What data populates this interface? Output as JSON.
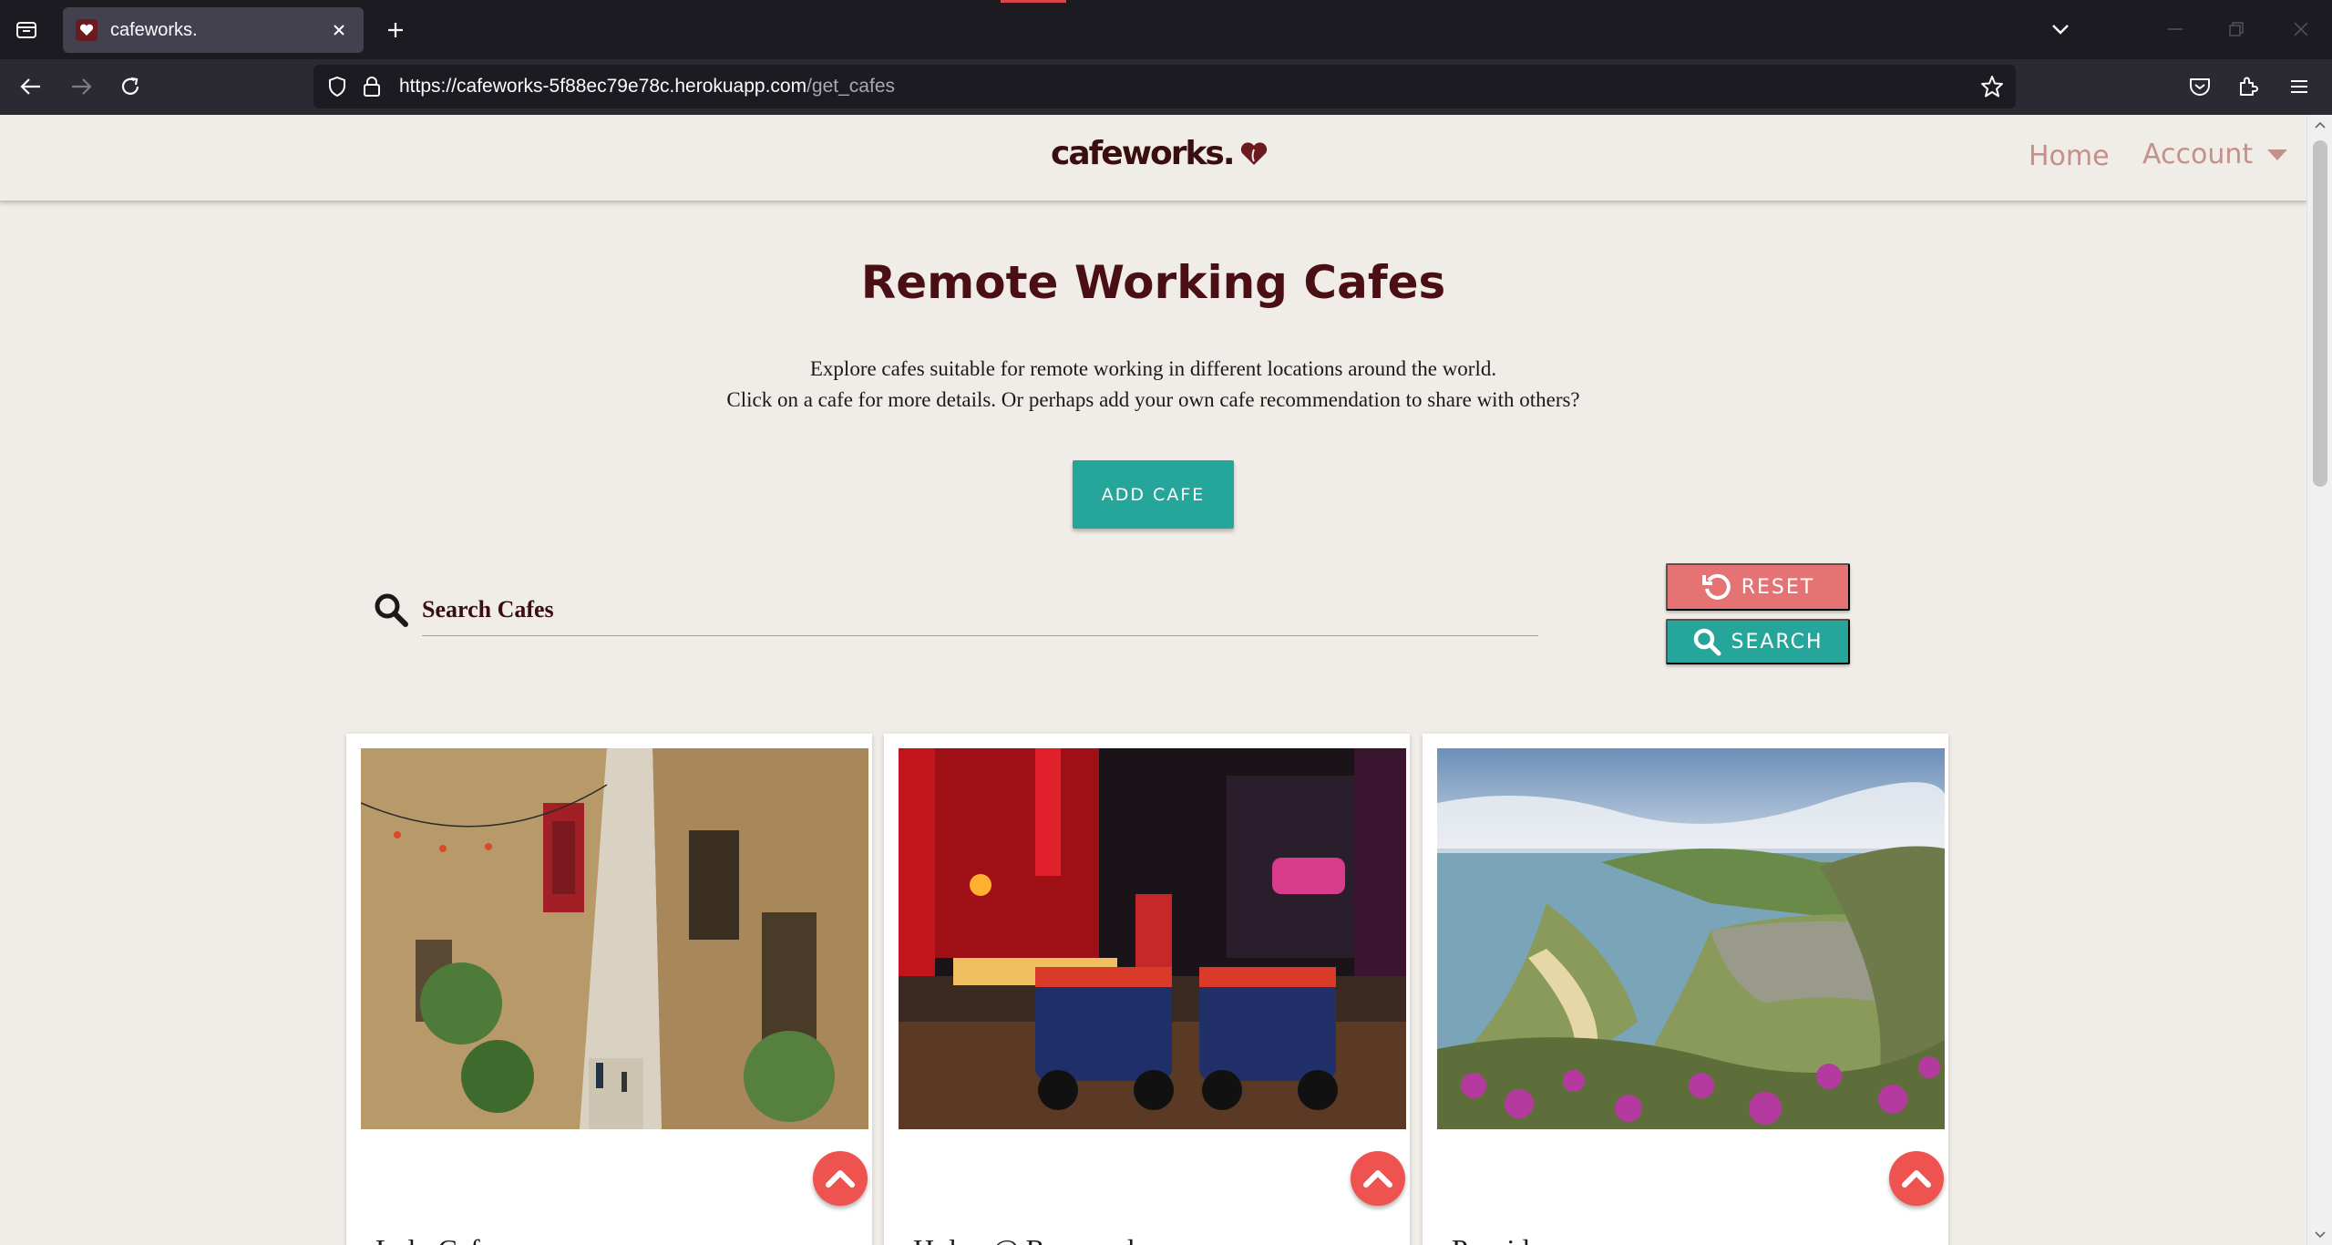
{
  "browser": {
    "tab_title": "cafeworks.",
    "url_host": "https://cafeworks-5f88ec79e78c.herokuapp.com",
    "url_path": "/get_cafes"
  },
  "site": {
    "logo": "cafeworks.",
    "nav": {
      "home": "Home",
      "account": "Account"
    },
    "title": "Remote Working Cafes",
    "intro_line1": "Explore cafes suitable for remote working in different locations around the world.",
    "intro_line2": "Click on a cafe for more details. Or perhaps add your own cafe recommendation to share with others?",
    "add_button": "ADD CAFE",
    "search": {
      "placeholder": "Search Cafes",
      "reset": "RESET",
      "submit": "SEARCH"
    },
    "cafes": [
      {
        "name": "Lulu Cafe"
      },
      {
        "name": "Holey @ Ruamrudee"
      },
      {
        "name": "Providero"
      }
    ]
  },
  "colors": {
    "accent_teal": "#26a69a",
    "accent_red": "#e57373",
    "fab_red": "#ef5350",
    "brand_dark": "#4a0f14",
    "nav_link": "#c4908a",
    "page_bg": "#f0ece7"
  },
  "icons": [
    "tab-list-icon",
    "favicon-heart-icon",
    "close-icon",
    "plus-icon",
    "chevron-down-icon",
    "minimize-icon",
    "restore-icon",
    "window-close-icon",
    "back-icon",
    "forward-icon",
    "reload-icon",
    "shield-icon",
    "lock-icon",
    "star-icon",
    "pocket-icon",
    "extensions-icon",
    "menu-icon",
    "search-icon",
    "reset-icon",
    "chevron-up-icon"
  ]
}
